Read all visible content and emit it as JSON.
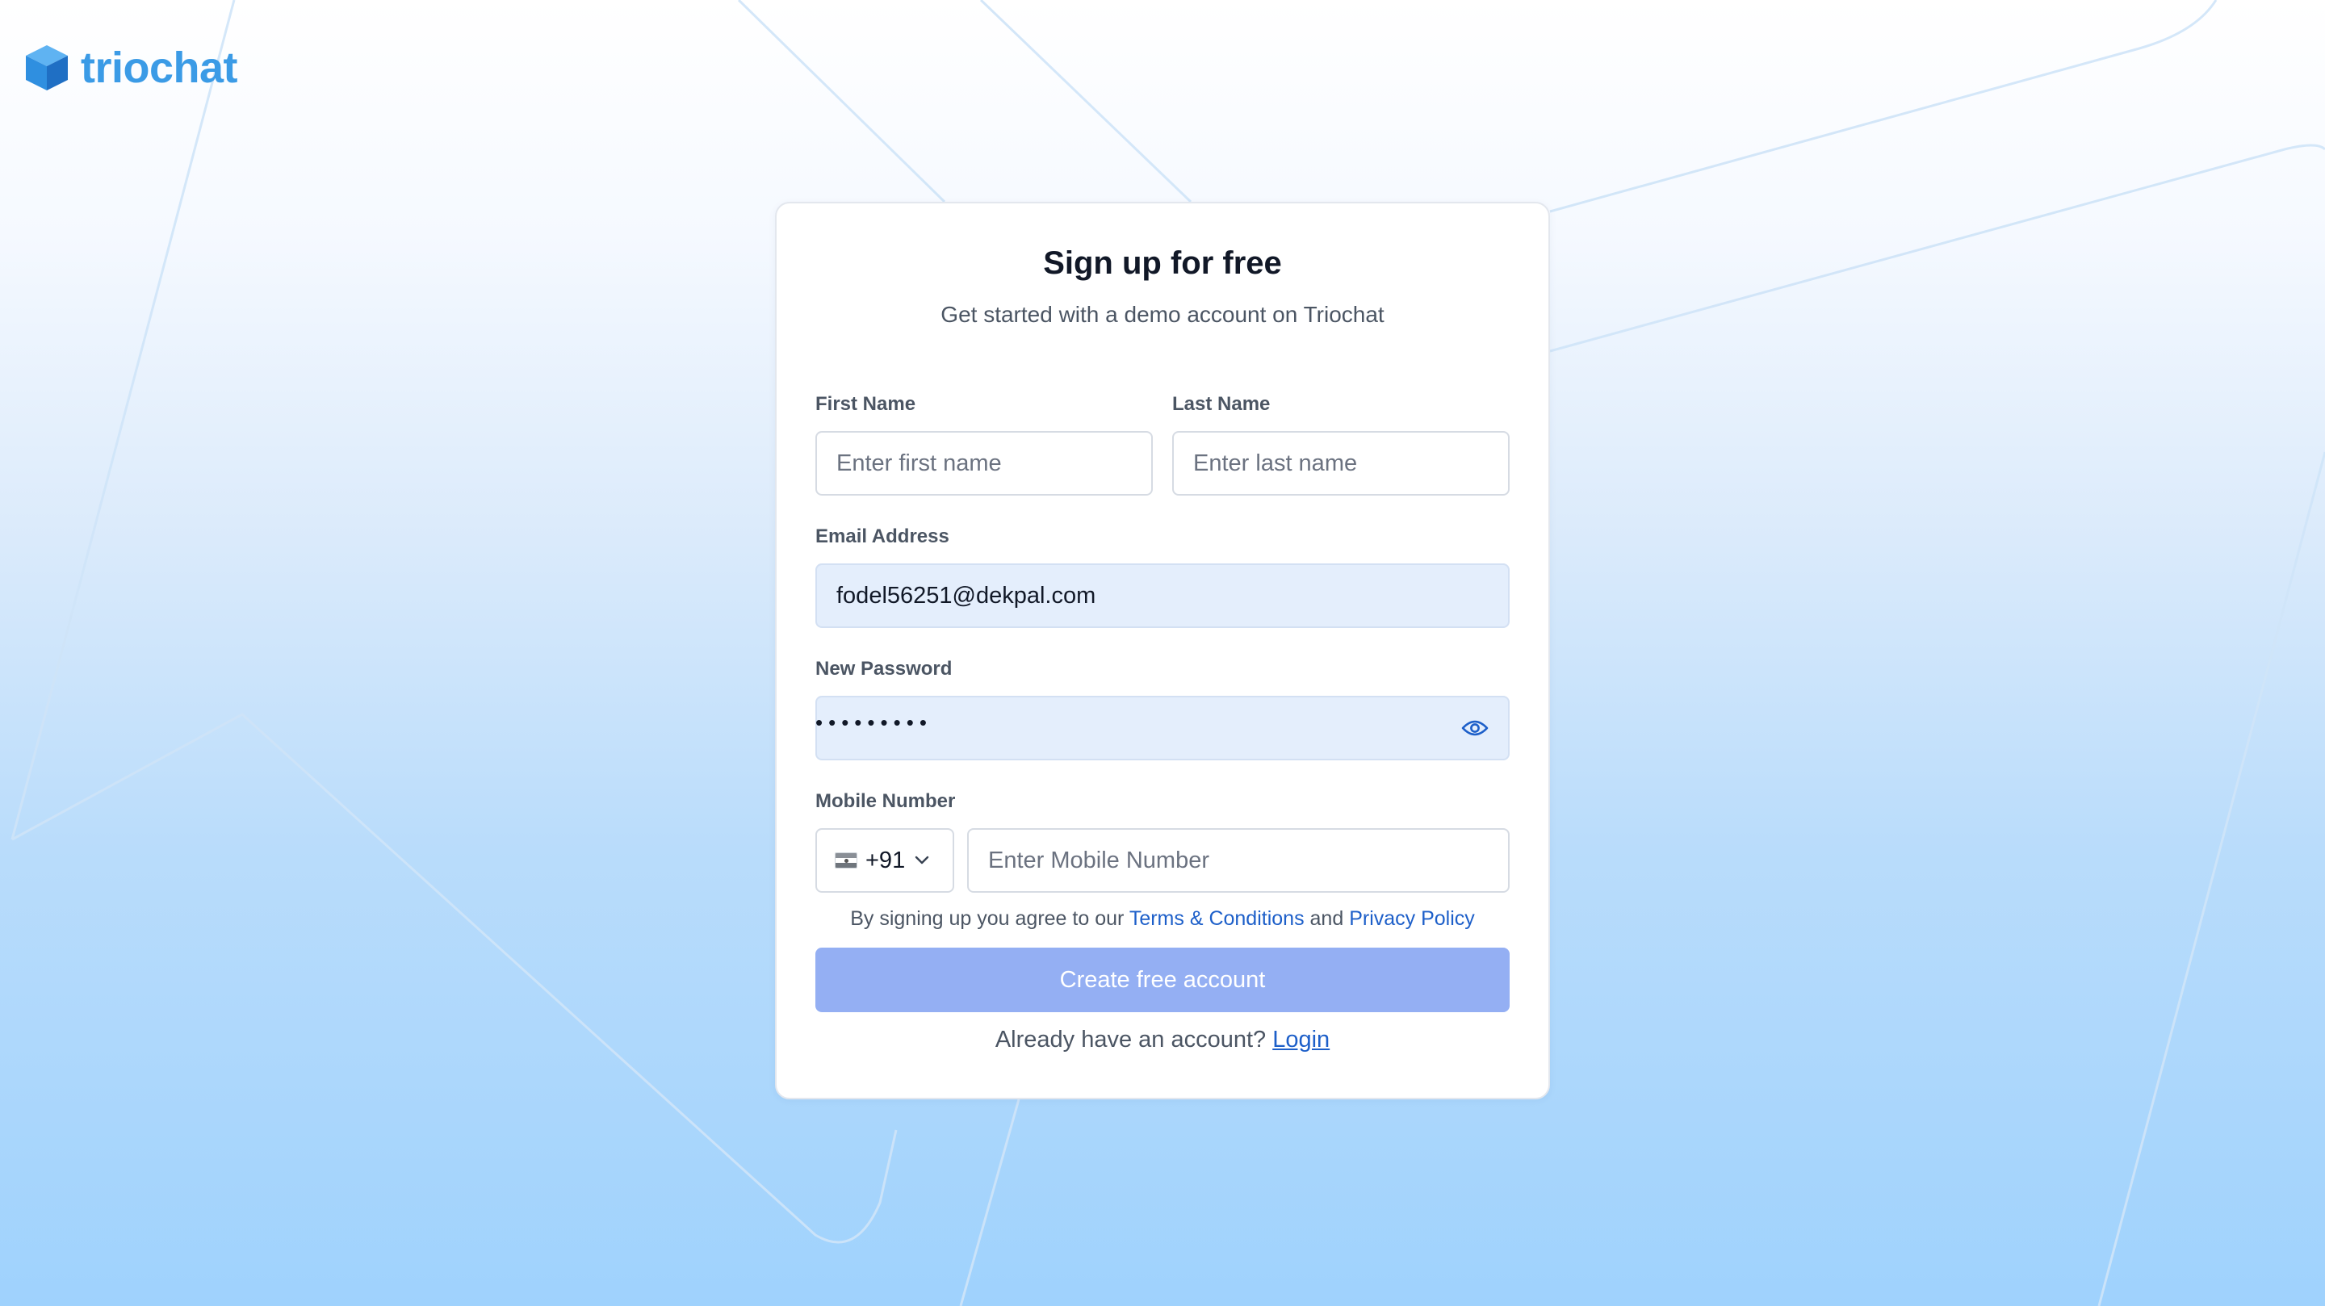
{
  "brand": {
    "name": "triochat"
  },
  "signup": {
    "title": "Sign up for free",
    "subtitle": "Get started with a demo account on Triochat",
    "first_name": {
      "label": "First Name",
      "placeholder": "Enter first name",
      "value": ""
    },
    "last_name": {
      "label": "Last Name",
      "placeholder": "Enter last name",
      "value": ""
    },
    "email": {
      "label": "Email Address",
      "value": "fodel56251@dekpal.com"
    },
    "password": {
      "label": "New Password",
      "masked_value": "•••••••••"
    },
    "mobile": {
      "label": "Mobile Number",
      "country_code": "+91",
      "placeholder": "Enter Mobile Number",
      "value": ""
    },
    "terms": {
      "prefix": "By signing up you agree to our ",
      "terms_link": "Terms & Conditions",
      "conjunction": " and ",
      "privacy_link": "Privacy Policy"
    },
    "submit_label": "Create free account",
    "login_prompt": "Already have an account? ",
    "login_link": "Login"
  },
  "icons": {
    "logo": "cube-logo-icon",
    "password_toggle": "eye-icon",
    "country_dropdown": "chevron-down-icon",
    "country_flag": "flag-icon"
  },
  "colors": {
    "brand": "#3b9be6",
    "link": "#1d5fc9",
    "button_disabled": "#94aff3",
    "autofill_background": "#e4eefc"
  }
}
